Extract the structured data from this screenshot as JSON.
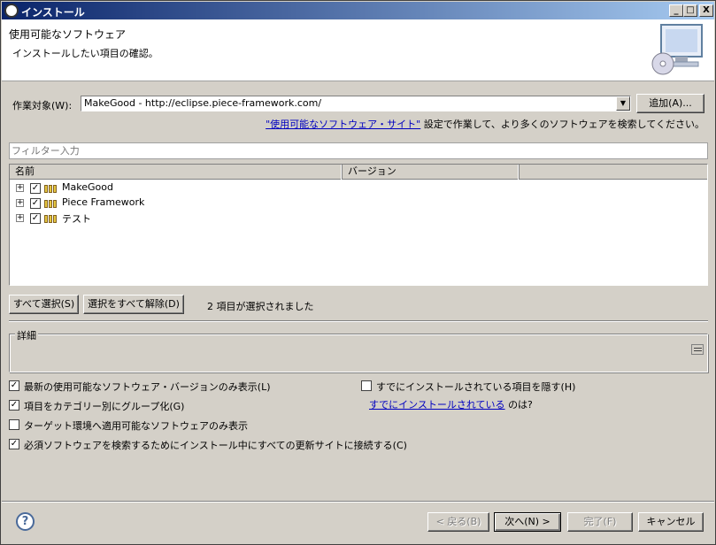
{
  "window": {
    "title": "インストール",
    "minimize": "_",
    "maximize": "□",
    "close": "X"
  },
  "header": {
    "title": "使用可能なソフトウェア",
    "subtitle": "インストールしたい項目の確認。"
  },
  "work_with": {
    "label": "作業対象(W):",
    "value": "MakeGood - http://eclipse.piece-framework.com/",
    "add_button": "追加(A)..."
  },
  "site_note": {
    "link": "\"使用可能なソフトウェア・サイト\"",
    "text": "設定で作業して、より多くのソフトウェアを検索してください。"
  },
  "filter": {
    "placeholder": "フィルター入力"
  },
  "tree": {
    "columns": [
      "名前",
      "バージョン"
    ],
    "items": [
      {
        "label": "MakeGood",
        "checked": true
      },
      {
        "label": "Piece Framework",
        "checked": true
      },
      {
        "label": "テスト",
        "checked": true
      }
    ]
  },
  "selection": {
    "select_all": "すべて選択(S)",
    "deselect_all": "選択をすべて解除(D)",
    "status": "2 項目が選択されました"
  },
  "details": {
    "label": "詳細"
  },
  "options": {
    "latest_only": "最新の使用可能なソフトウェア・バージョンのみ表示(L)",
    "group_by_category": "項目をカテゴリー別にグループ化(G)",
    "target_only": "ターゲット環境へ適用可能なソフトウェアのみ表示",
    "contact_all": "必須ソフトウェアを検索するためにインストール中にすべての更新サイトに接続する(C)",
    "hide_installed": "すでにインストールされている項目を隠す(H)",
    "installed_link": "すでにインストールされている",
    "installed_suffix": "のは?"
  },
  "footer": {
    "help": "?",
    "back": "< 戻る(B)",
    "next": "次へ(N) >",
    "finish": "完了(F)",
    "cancel": "キャンセル"
  }
}
